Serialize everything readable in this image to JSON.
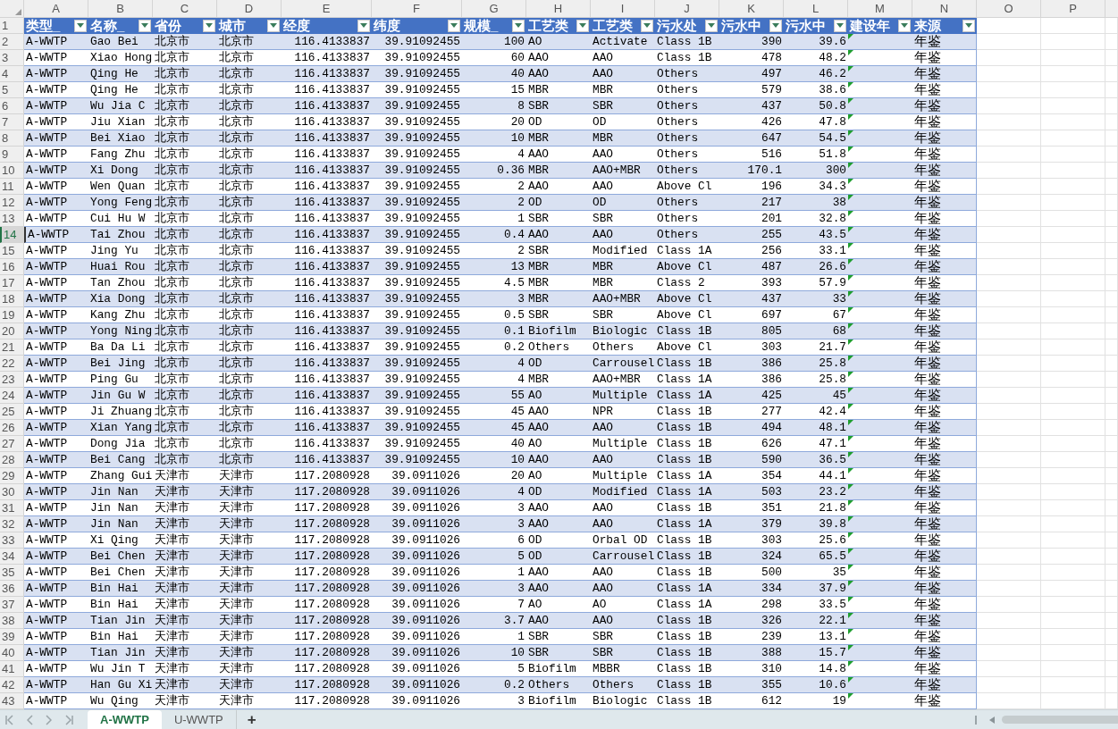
{
  "column_letters": [
    "A",
    "B",
    "C",
    "D",
    "E",
    "F",
    "G",
    "H",
    "I",
    "J",
    "K",
    "L",
    "M",
    "N",
    "O",
    "P"
  ],
  "header_row": {
    "number": "1",
    "headers": [
      "类型_",
      "名称_",
      "省份",
      "城市",
      "经度",
      "纬度",
      "规模_",
      "工艺类",
      "工艺类",
      "污水处",
      "污水中",
      "污水中",
      "建设年",
      "来源"
    ]
  },
  "rows": [
    {
      "number": "2",
      "selected": false,
      "flagged": true,
      "cells": [
        "A-WWTP",
        "Gao Bei",
        "北京市",
        "北京市",
        "116.4133837",
        "39.91092455",
        "100",
        "AO",
        "Activate",
        "Class 1B",
        "390",
        "39.6"
      ],
      "source": "年鉴"
    },
    {
      "number": "3",
      "selected": false,
      "flagged": true,
      "cells": [
        "A-WWTP",
        "Xiao Hong",
        "北京市",
        "北京市",
        "116.4133837",
        "39.91092455",
        "60",
        "AAO",
        "AAO",
        "Class 1B",
        "478",
        "48.2"
      ],
      "source": "年鉴"
    },
    {
      "number": "4",
      "selected": false,
      "flagged": true,
      "cells": [
        "A-WWTP",
        "Qing He",
        "北京市",
        "北京市",
        "116.4133837",
        "39.91092455",
        "40",
        "AAO",
        "AAO",
        "Others",
        "497",
        "46.2"
      ],
      "source": "年鉴"
    },
    {
      "number": "5",
      "selected": false,
      "flagged": true,
      "cells": [
        "A-WWTP",
        "Qing He",
        "北京市",
        "北京市",
        "116.4133837",
        "39.91092455",
        "15",
        "MBR",
        "MBR",
        "Others",
        "579",
        "38.6"
      ],
      "source": "年鉴"
    },
    {
      "number": "6",
      "selected": false,
      "flagged": true,
      "cells": [
        "A-WWTP",
        "Wu Jia C",
        "北京市",
        "北京市",
        "116.4133837",
        "39.91092455",
        "8",
        "SBR",
        "SBR",
        "Others",
        "437",
        "50.8"
      ],
      "source": "年鉴"
    },
    {
      "number": "7",
      "selected": false,
      "flagged": true,
      "cells": [
        "A-WWTP",
        "Jiu Xian",
        "北京市",
        "北京市",
        "116.4133837",
        "39.91092455",
        "20",
        "OD",
        "OD",
        "Others",
        "426",
        "47.8"
      ],
      "source": "年鉴"
    },
    {
      "number": "8",
      "selected": false,
      "flagged": true,
      "cells": [
        "A-WWTP",
        "Bei Xiao",
        "北京市",
        "北京市",
        "116.4133837",
        "39.91092455",
        "10",
        "MBR",
        "MBR",
        "Others",
        "647",
        "54.5"
      ],
      "source": "年鉴"
    },
    {
      "number": "9",
      "selected": false,
      "flagged": true,
      "cells": [
        "A-WWTP",
        "Fang Zhu",
        "北京市",
        "北京市",
        "116.4133837",
        "39.91092455",
        "4",
        "AAO",
        "AAO",
        "Others",
        "516",
        "51.8"
      ],
      "source": "年鉴"
    },
    {
      "number": "10",
      "selected": false,
      "flagged": true,
      "cells": [
        "A-WWTP",
        "Xi Dong",
        "北京市",
        "北京市",
        "116.4133837",
        "39.91092455",
        "0.36",
        "MBR",
        "AAO+MBR",
        "Others",
        "170.1",
        "300"
      ],
      "source": "年鉴"
    },
    {
      "number": "11",
      "selected": false,
      "flagged": true,
      "cells": [
        "A-WWTP",
        "Wen Quan",
        "北京市",
        "北京市",
        "116.4133837",
        "39.91092455",
        "2",
        "AAO",
        "AAO",
        "Above Cl",
        "196",
        "34.3"
      ],
      "source": "年鉴"
    },
    {
      "number": "12",
      "selected": false,
      "flagged": true,
      "cells": [
        "A-WWTP",
        "Yong Feng",
        "北京市",
        "北京市",
        "116.4133837",
        "39.91092455",
        "2",
        "OD",
        "OD",
        "Others",
        "217",
        "38"
      ],
      "source": "年鉴"
    },
    {
      "number": "13",
      "selected": false,
      "flagged": true,
      "cells": [
        "A-WWTP",
        "Cui Hu W",
        "北京市",
        "北京市",
        "116.4133837",
        "39.91092455",
        "1",
        "SBR",
        "SBR",
        "Others",
        "201",
        "32.8"
      ],
      "source": "年鉴"
    },
    {
      "number": "14",
      "selected": true,
      "flagged": true,
      "cells": [
        "A-WWTP",
        "Tai Zhou",
        "北京市",
        "北京市",
        "116.4133837",
        "39.91092455",
        "0.4",
        "AAO",
        "AAO",
        "Others",
        "255",
        "43.5"
      ],
      "source": "年鉴"
    },
    {
      "number": "15",
      "selected": false,
      "flagged": true,
      "cells": [
        "A-WWTP",
        "Jing Yu",
        "北京市",
        "北京市",
        "116.4133837",
        "39.91092455",
        "2",
        "SBR",
        "Modified",
        "Class 1A",
        "256",
        "33.1"
      ],
      "source": "年鉴"
    },
    {
      "number": "16",
      "selected": false,
      "flagged": true,
      "cells": [
        "A-WWTP",
        "Huai Rou",
        "北京市",
        "北京市",
        "116.4133837",
        "39.91092455",
        "13",
        "MBR",
        "MBR",
        "Above Cl",
        "487",
        "26.6"
      ],
      "source": "年鉴"
    },
    {
      "number": "17",
      "selected": false,
      "flagged": true,
      "cells": [
        "A-WWTP",
        "Tan Zhou",
        "北京市",
        "北京市",
        "116.4133837",
        "39.91092455",
        "4.5",
        "MBR",
        "MBR",
        "Class 2",
        "393",
        "57.9"
      ],
      "source": "年鉴"
    },
    {
      "number": "18",
      "selected": false,
      "flagged": true,
      "cells": [
        "A-WWTP",
        "Xia Dong",
        "北京市",
        "北京市",
        "116.4133837",
        "39.91092455",
        "3",
        "MBR",
        "AAO+MBR",
        "Above Cl",
        "437",
        "33"
      ],
      "source": "年鉴"
    },
    {
      "number": "19",
      "selected": false,
      "flagged": true,
      "cells": [
        "A-WWTP",
        "Kang Zhu",
        "北京市",
        "北京市",
        "116.4133837",
        "39.91092455",
        "0.5",
        "SBR",
        "SBR",
        "Above Cl",
        "697",
        "67"
      ],
      "source": "年鉴"
    },
    {
      "number": "20",
      "selected": false,
      "flagged": true,
      "cells": [
        "A-WWTP",
        "Yong Ning",
        "北京市",
        "北京市",
        "116.4133837",
        "39.91092455",
        "0.1",
        "Biofilm",
        "Biologic",
        "Class 1B",
        "805",
        "68"
      ],
      "source": "年鉴"
    },
    {
      "number": "21",
      "selected": false,
      "flagged": true,
      "cells": [
        "A-WWTP",
        "Ba Da Li",
        "北京市",
        "北京市",
        "116.4133837",
        "39.91092455",
        "0.2",
        "Others",
        "Others",
        "Above Cl",
        "303",
        "21.7"
      ],
      "source": "年鉴"
    },
    {
      "number": "22",
      "selected": false,
      "flagged": true,
      "cells": [
        "A-WWTP",
        "Bei Jing",
        "北京市",
        "北京市",
        "116.4133837",
        "39.91092455",
        "4",
        "OD",
        "Carrousel",
        "Class 1B",
        "386",
        "25.8"
      ],
      "source": "年鉴"
    },
    {
      "number": "23",
      "selected": false,
      "flagged": true,
      "cells": [
        "A-WWTP",
        "Ping Gu",
        "北京市",
        "北京市",
        "116.4133837",
        "39.91092455",
        "4",
        "MBR",
        "AAO+MBR",
        "Class 1A",
        "386",
        "25.8"
      ],
      "source": "年鉴"
    },
    {
      "number": "24",
      "selected": false,
      "flagged": true,
      "cells": [
        "A-WWTP",
        "Jin Gu W",
        "北京市",
        "北京市",
        "116.4133837",
        "39.91092455",
        "55",
        "AO",
        "Multiple",
        "Class 1A",
        "425",
        "45"
      ],
      "source": "年鉴"
    },
    {
      "number": "25",
      "selected": false,
      "flagged": true,
      "cells": [
        "A-WWTP",
        "Ji Zhuang",
        "北京市",
        "北京市",
        "116.4133837",
        "39.91092455",
        "45",
        "AAO",
        "NPR",
        "Class 1B",
        "277",
        "42.4"
      ],
      "source": "年鉴"
    },
    {
      "number": "26",
      "selected": false,
      "flagged": true,
      "cells": [
        "A-WWTP",
        "Xian Yang",
        "北京市",
        "北京市",
        "116.4133837",
        "39.91092455",
        "45",
        "AAO",
        "AAO",
        "Class 1B",
        "494",
        "48.1"
      ],
      "source": "年鉴"
    },
    {
      "number": "27",
      "selected": false,
      "flagged": true,
      "cells": [
        "A-WWTP",
        "Dong Jia",
        "北京市",
        "北京市",
        "116.4133837",
        "39.91092455",
        "40",
        "AO",
        "Multiple",
        "Class 1B",
        "626",
        "47.1"
      ],
      "source": "年鉴"
    },
    {
      "number": "28",
      "selected": false,
      "flagged": true,
      "cells": [
        "A-WWTP",
        "Bei Cang",
        "北京市",
        "北京市",
        "116.4133837",
        "39.91092455",
        "10",
        "AAO",
        "AAO",
        "Class 1B",
        "590",
        "36.5"
      ],
      "source": "年鉴"
    },
    {
      "number": "29",
      "selected": false,
      "flagged": true,
      "cells": [
        "A-WWTP",
        "Zhang Gui",
        "天津市",
        "天津市",
        "117.2080928",
        "39.0911026",
        "20",
        "AO",
        "Multiple",
        "Class 1A",
        "354",
        "44.1"
      ],
      "source": "年鉴"
    },
    {
      "number": "30",
      "selected": false,
      "flagged": true,
      "cells": [
        "A-WWTP",
        "Jin Nan",
        "天津市",
        "天津市",
        "117.2080928",
        "39.0911026",
        "4",
        "OD",
        "Modified",
        "Class 1A",
        "503",
        "23.2"
      ],
      "source": "年鉴"
    },
    {
      "number": "31",
      "selected": false,
      "flagged": true,
      "cells": [
        "A-WWTP",
        "Jin Nan",
        "天津市",
        "天津市",
        "117.2080928",
        "39.0911026",
        "3",
        "AAO",
        "AAO",
        "Class 1B",
        "351",
        "21.8"
      ],
      "source": "年鉴"
    },
    {
      "number": "32",
      "selected": false,
      "flagged": true,
      "cells": [
        "A-WWTP",
        "Jin Nan",
        "天津市",
        "天津市",
        "117.2080928",
        "39.0911026",
        "3",
        "AAO",
        "AAO",
        "Class 1A",
        "379",
        "39.8"
      ],
      "source": "年鉴"
    },
    {
      "number": "33",
      "selected": false,
      "flagged": true,
      "cells": [
        "A-WWTP",
        "Xi Qing",
        "天津市",
        "天津市",
        "117.2080928",
        "39.0911026",
        "6",
        "OD",
        "Orbal OD",
        "Class 1B",
        "303",
        "25.6"
      ],
      "source": "年鉴"
    },
    {
      "number": "34",
      "selected": false,
      "flagged": true,
      "cells": [
        "A-WWTP",
        "Bei Chen",
        "天津市",
        "天津市",
        "117.2080928",
        "39.0911026",
        "5",
        "OD",
        "Carrousel",
        "Class 1B",
        "324",
        "65.5"
      ],
      "source": "年鉴"
    },
    {
      "number": "35",
      "selected": false,
      "flagged": true,
      "cells": [
        "A-WWTP",
        "Bei Chen",
        "天津市",
        "天津市",
        "117.2080928",
        "39.0911026",
        "1",
        "AAO",
        "AAO",
        "Class 1B",
        "500",
        "35"
      ],
      "source": "年鉴"
    },
    {
      "number": "36",
      "selected": false,
      "flagged": true,
      "cells": [
        "A-WWTP",
        "Bin Hai",
        "天津市",
        "天津市",
        "117.2080928",
        "39.0911026",
        "3",
        "AAO",
        "AAO",
        "Class 1A",
        "334",
        "37.9"
      ],
      "source": "年鉴"
    },
    {
      "number": "37",
      "selected": false,
      "flagged": true,
      "cells": [
        "A-WWTP",
        "Bin Hai",
        "天津市",
        "天津市",
        "117.2080928",
        "39.0911026",
        "7",
        "AO",
        "AO",
        "Class 1A",
        "298",
        "33.5"
      ],
      "source": "年鉴"
    },
    {
      "number": "38",
      "selected": false,
      "flagged": true,
      "cells": [
        "A-WWTP",
        "Tian Jin",
        "天津市",
        "天津市",
        "117.2080928",
        "39.0911026",
        "3.7",
        "AAO",
        "AAO",
        "Class 1B",
        "326",
        "22.1"
      ],
      "source": "年鉴"
    },
    {
      "number": "39",
      "selected": false,
      "flagged": true,
      "cells": [
        "A-WWTP",
        "Bin Hai",
        "天津市",
        "天津市",
        "117.2080928",
        "39.0911026",
        "1",
        "SBR",
        "SBR",
        "Class 1B",
        "239",
        "13.1"
      ],
      "source": "年鉴"
    },
    {
      "number": "40",
      "selected": false,
      "flagged": true,
      "cells": [
        "A-WWTP",
        "Tian Jin",
        "天津市",
        "天津市",
        "117.2080928",
        "39.0911026",
        "10",
        "SBR",
        "SBR",
        "Class 1B",
        "388",
        "15.7"
      ],
      "source": "年鉴"
    },
    {
      "number": "41",
      "selected": false,
      "flagged": true,
      "cells": [
        "A-WWTP",
        "Wu Jin T",
        "天津市",
        "天津市",
        "117.2080928",
        "39.0911026",
        "5",
        "Biofilm",
        "MBBR",
        "Class 1B",
        "310",
        "14.8"
      ],
      "source": "年鉴"
    },
    {
      "number": "42",
      "selected": false,
      "flagged": true,
      "cells": [
        "A-WWTP",
        "Han Gu Xi",
        "天津市",
        "天津市",
        "117.2080928",
        "39.0911026",
        "0.2",
        "Others",
        "Others",
        "Class 1B",
        "355",
        "10.6"
      ],
      "source": "年鉴"
    },
    {
      "number": "43",
      "selected": false,
      "flagged": true,
      "cells": [
        "A-WWTP",
        "Wu Qing",
        "天津市",
        "天津市",
        "117.2080928",
        "39.0911026",
        "3",
        "Biofilm",
        "Biologic",
        "Class 1B",
        "612",
        "19"
      ],
      "source": "年鉴"
    }
  ],
  "sheet_tabs": [
    {
      "label": "A-WWTP",
      "selected": true
    },
    {
      "label": "U-WWTP",
      "selected": false
    }
  ],
  "add_sheet": "+"
}
